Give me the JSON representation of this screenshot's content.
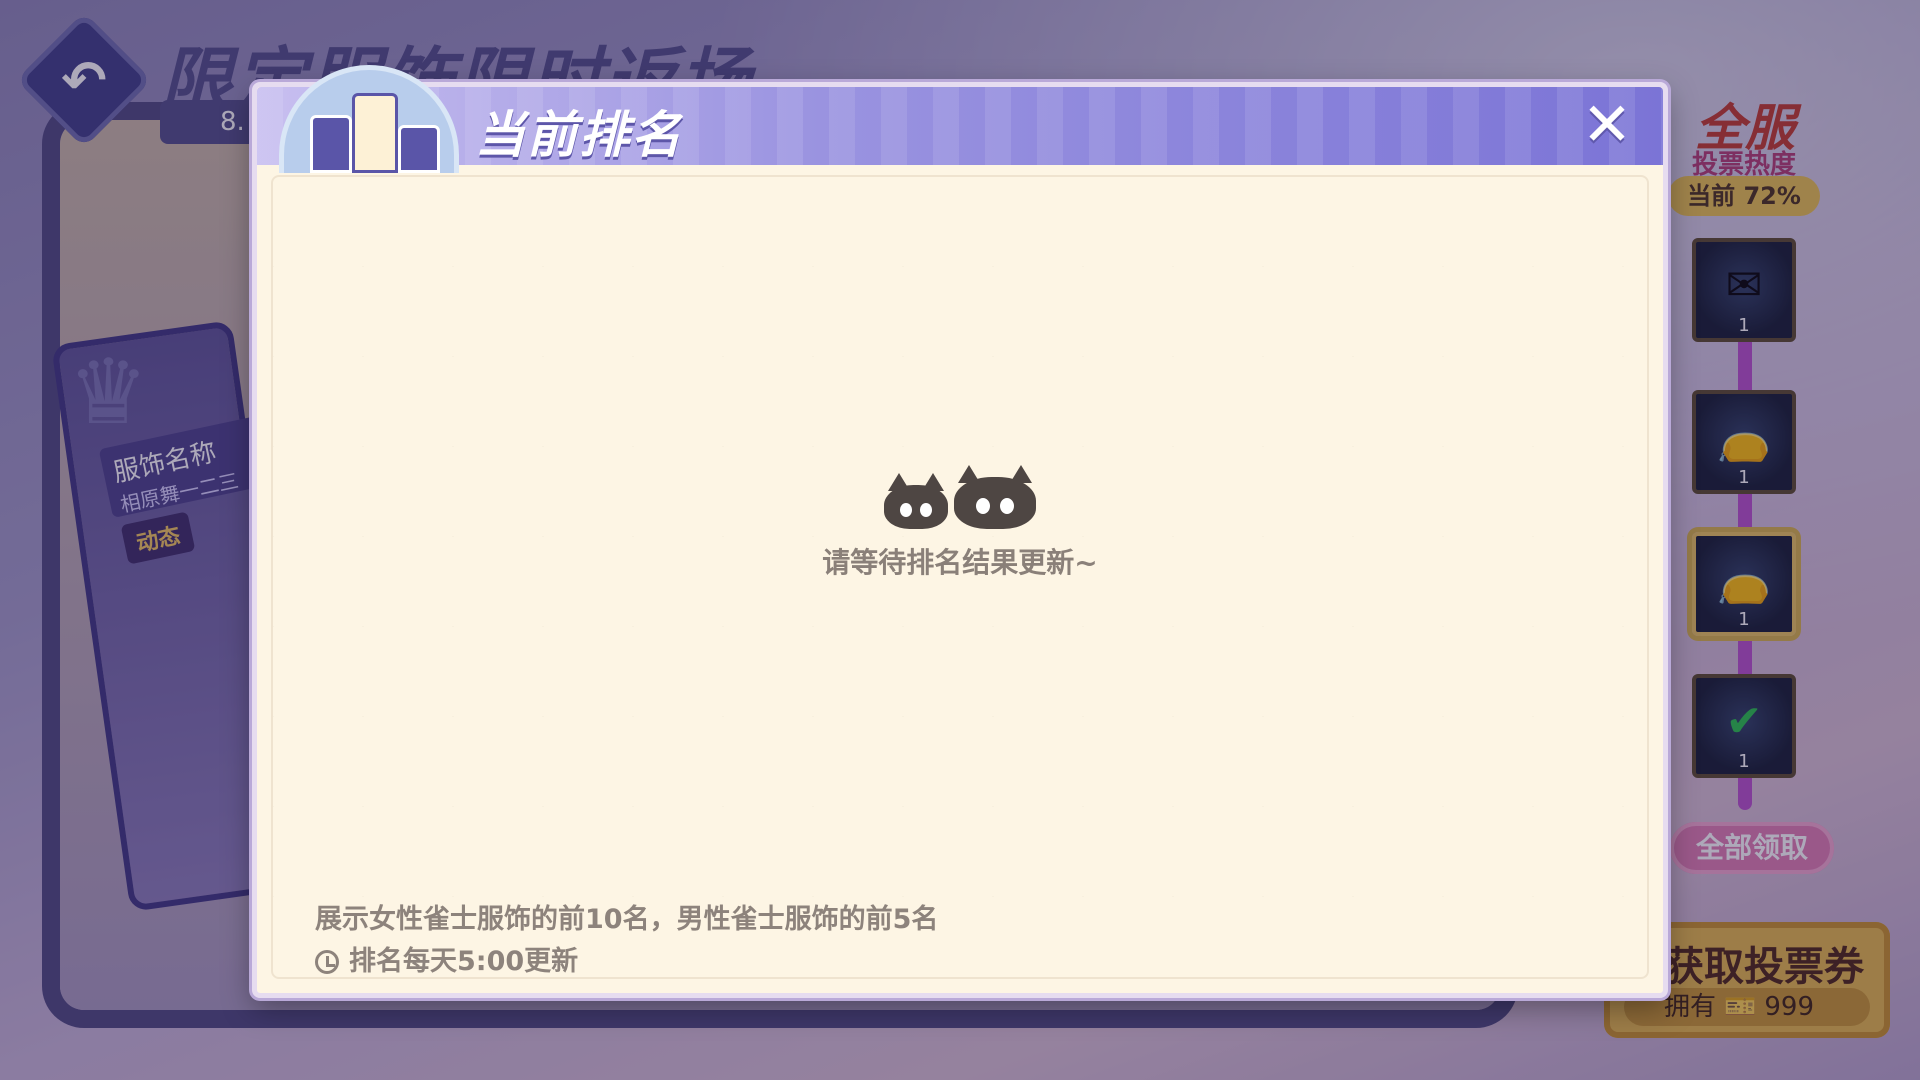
{
  "background": {
    "event_title": "限定服饰限时返场",
    "timer_text": "8.",
    "card": {
      "name_label": "服饰名称",
      "sub_label": "相原舞一二三",
      "tag": "动态"
    },
    "heat": {
      "title": "全服",
      "subtitle": "投票热度",
      "current": "当前 72%"
    },
    "rewards": [
      {
        "icon": "envelope-icon",
        "count": "1",
        "selected": false
      },
      {
        "icon": "pouch-icon",
        "count": "1",
        "selected": false
      },
      {
        "icon": "pouch-icon",
        "count": "1",
        "selected": true
      },
      {
        "icon": "claimed-check-icon",
        "count": "1",
        "selected": false
      }
    ],
    "claim_all": "全部领取",
    "vote_ticket": {
      "title": "获取投票券",
      "owned_label": "拥有",
      "count": "999"
    }
  },
  "modal": {
    "title": "当前排名",
    "empty_message": "请等待排名结果更新~",
    "footer_note": "展示女性雀士服饰的前10名，男性雀士服饰的前5名",
    "update_note": "排名每天5:00更新",
    "colors": {
      "header": "#8f88de",
      "body": "#fdf5e4",
      "text_muted": "#8d837c"
    }
  }
}
